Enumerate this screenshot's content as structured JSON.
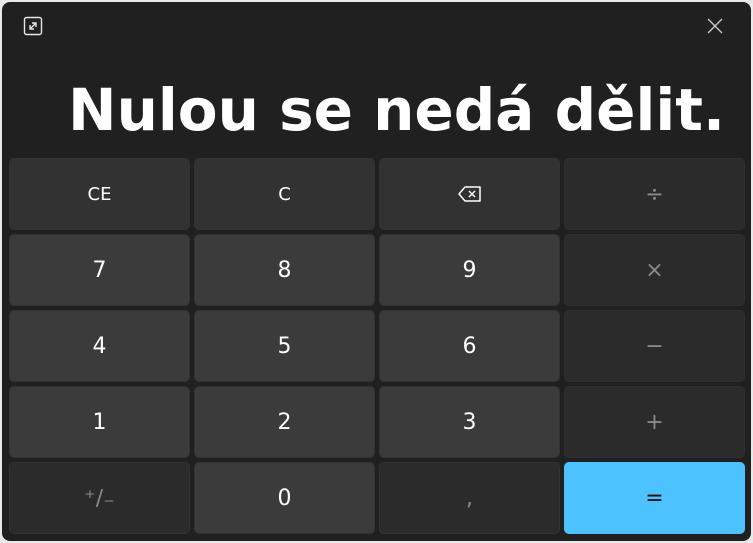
{
  "display": {
    "text": "Nulou se nedá dělit."
  },
  "keypad": {
    "ce": "CE",
    "c": "C",
    "backspace_icon": "backspace-icon",
    "divide": "÷",
    "multiply": "×",
    "minus": "−",
    "plus": "+",
    "d7": "7",
    "d8": "8",
    "d9": "9",
    "d4": "4",
    "d5": "5",
    "d6": "6",
    "d1": "1",
    "d2": "2",
    "d3": "3",
    "negate": "⁺∕₋",
    "d0": "0",
    "decimal": ",",
    "equals": "="
  },
  "colors": {
    "window_bg": "#202020",
    "key_bg": "#3b3b3b",
    "operator_bg": "#2b2b2b",
    "accent": "#4cc2ff"
  }
}
